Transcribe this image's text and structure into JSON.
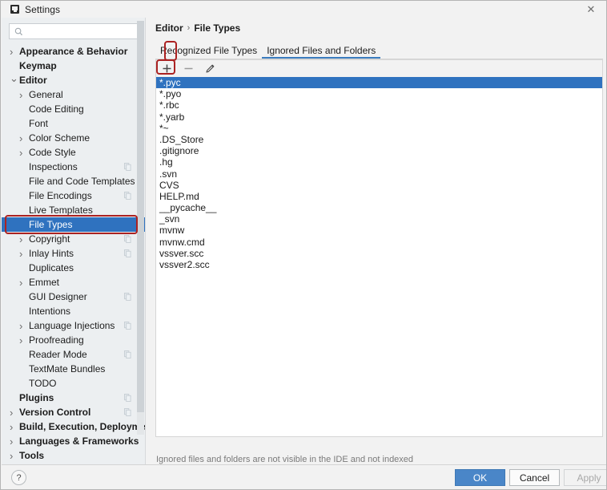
{
  "window": {
    "title": "Settings",
    "icon": "settings-app-icon",
    "close_label": "✕"
  },
  "sidebar": {
    "search": {
      "placeholder": "",
      "value": "",
      "icon": "search-icon"
    },
    "items": [
      {
        "label": "Appearance & Behavior",
        "level": 1,
        "chevron": "collapsed",
        "badge": false
      },
      {
        "label": "Keymap",
        "level": 1,
        "chevron": "none",
        "badge": false
      },
      {
        "label": "Editor",
        "level": 1,
        "chevron": "expanded",
        "badge": false
      },
      {
        "label": "General",
        "level": 2,
        "chevron": "collapsed",
        "badge": false
      },
      {
        "label": "Code Editing",
        "level": 2,
        "chevron": "none",
        "badge": false
      },
      {
        "label": "Font",
        "level": 2,
        "chevron": "none",
        "badge": false
      },
      {
        "label": "Color Scheme",
        "level": 2,
        "chevron": "collapsed",
        "badge": false
      },
      {
        "label": "Code Style",
        "level": 2,
        "chevron": "collapsed",
        "badge": false
      },
      {
        "label": "Inspections",
        "level": 2,
        "chevron": "none",
        "badge": true
      },
      {
        "label": "File and Code Templates",
        "level": 2,
        "chevron": "none",
        "badge": false
      },
      {
        "label": "File Encodings",
        "level": 2,
        "chevron": "none",
        "badge": true
      },
      {
        "label": "Live Templates",
        "level": 2,
        "chevron": "none",
        "badge": false
      },
      {
        "label": "File Types",
        "level": 2,
        "chevron": "none",
        "badge": false,
        "selected": true,
        "highlighted": true
      },
      {
        "label": "Copyright",
        "level": 2,
        "chevron": "collapsed",
        "badge": true
      },
      {
        "label": "Inlay Hints",
        "level": 2,
        "chevron": "collapsed",
        "badge": true
      },
      {
        "label": "Duplicates",
        "level": 2,
        "chevron": "none",
        "badge": false
      },
      {
        "label": "Emmet",
        "level": 2,
        "chevron": "collapsed",
        "badge": false
      },
      {
        "label": "GUI Designer",
        "level": 2,
        "chevron": "none",
        "badge": true
      },
      {
        "label": "Intentions",
        "level": 2,
        "chevron": "none",
        "badge": false
      },
      {
        "label": "Language Injections",
        "level": 2,
        "chevron": "collapsed",
        "badge": true
      },
      {
        "label": "Proofreading",
        "level": 2,
        "chevron": "collapsed",
        "badge": false
      },
      {
        "label": "Reader Mode",
        "level": 2,
        "chevron": "none",
        "badge": true
      },
      {
        "label": "TextMate Bundles",
        "level": 2,
        "chevron": "none",
        "badge": false
      },
      {
        "label": "TODO",
        "level": 2,
        "chevron": "none",
        "badge": false
      },
      {
        "label": "Plugins",
        "level": 1,
        "chevron": "none",
        "badge": true
      },
      {
        "label": "Version Control",
        "level": 1,
        "chevron": "collapsed",
        "badge": true
      },
      {
        "label": "Build, Execution, Deployment",
        "level": 1,
        "chevron": "collapsed",
        "badge": false
      },
      {
        "label": "Languages & Frameworks",
        "level": 1,
        "chevron": "collapsed",
        "badge": false
      },
      {
        "label": "Tools",
        "level": 1,
        "chevron": "collapsed",
        "badge": false
      }
    ]
  },
  "main": {
    "breadcrumb": {
      "root": "Editor",
      "separator": "›",
      "leaf": "File Types"
    },
    "tabs": [
      {
        "label": "Recognized File Types",
        "active": false
      },
      {
        "label": "Ignored Files and Folders",
        "active": true,
        "highlighted": true
      }
    ],
    "toolbar": [
      {
        "name": "add-button",
        "glyph": "+",
        "enabled": true,
        "highlighted": true
      },
      {
        "name": "remove-button",
        "glyph": "−",
        "enabled": false,
        "highlighted": false
      },
      {
        "name": "edit-button",
        "glyph": "pencil",
        "enabled": true,
        "highlighted": false
      }
    ],
    "list": {
      "items": [
        "*.pyc",
        "*.pyo",
        "*.rbc",
        "*.yarb",
        "*~",
        ".DS_Store",
        ".gitignore",
        ".hg",
        ".svn",
        "CVS",
        "HELP.md",
        "__pycache__",
        "_svn",
        "mvnw",
        "mvnw.cmd",
        "vssver.scc",
        "vssver2.scc"
      ],
      "selected_index": 0
    },
    "hint": "Ignored files and folders are not visible in the IDE and not indexed"
  },
  "footer": {
    "help_label": "?",
    "ok_label": "OK",
    "cancel_label": "Cancel",
    "apply_label": "Apply"
  },
  "colors": {
    "selection_blue": "#2f72bf",
    "highlight_red": "#ab2222",
    "ok_button": "#4a86c8",
    "sidebar_bg": "#eceff1",
    "panel_bg": "#f2f2f2"
  }
}
